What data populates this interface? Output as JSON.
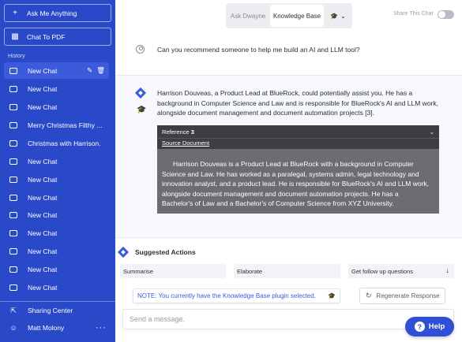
{
  "sidebar": {
    "ask_label": "Ask Me Anything",
    "pdf_label": "Chat To PDF",
    "history_label": "History",
    "items": [
      {
        "label": "New Chat"
      },
      {
        "label": "New Chat"
      },
      {
        "label": "New Chat"
      },
      {
        "label": "Merry Christmas Filthy ..."
      },
      {
        "label": "Christmas with Harrison."
      },
      {
        "label": "New Chat"
      },
      {
        "label": "New Chat"
      },
      {
        "label": "New Chat"
      },
      {
        "label": "New Chat"
      },
      {
        "label": "New Chat"
      },
      {
        "label": "New Chat"
      },
      {
        "label": "New Chat"
      },
      {
        "label": "New Chat"
      }
    ],
    "sharing_label": "Sharing Center",
    "user_name": "Matt Molony"
  },
  "topbar": {
    "mode_ask": "Ask Dwayne",
    "mode_kb": "Knowledge Base",
    "share_label": "Share This Chat"
  },
  "chat": {
    "user_message": "Can you recommend someone to help me build an AI and LLM tool?",
    "bot_message": "Harrison Douveas, a Product Lead at BlueRock, could potentially assist you. He has a background in Computer Science and Law and is responsible for BlueRock's AI and LLM work, alongside document management and document automation projects [3].",
    "reference": {
      "title_prefix": "Reference",
      "number": "3",
      "source_link": "Source Document",
      "body": "Harrison Douveas is a Product Lead at BlueRock with a background in Computer Science and Law. He has worked as a paralegal, systems admin, legal technology and innovation analyst, and a product lead. He is responsible for BlueRock's AI and LLM work, alongside document management and document automation projects. He has a Bachelor's of Law and a Bachelor's of Computer Science from XYZ University."
    }
  },
  "suggestions": {
    "title": "Suggested Actions",
    "items": [
      "Summarise",
      "Elaborate",
      "Get follow up questions"
    ]
  },
  "note": "NOTE: You currently have the Knowledge Base plugin selected.",
  "regenerate_label": "Regenerate Response",
  "input": {
    "placeholder": "Send a message."
  },
  "help_label": "Help",
  "colors": {
    "sidebar": "#2a49c9",
    "accent": "#3b5bdb",
    "help": "#2f4fd6",
    "reference_bg": "#6b6d71"
  },
  "icons": [
    "plus-icon",
    "pdf-icon",
    "chat-bubble-icon",
    "edit-icon",
    "trash-icon",
    "share-icon",
    "user-icon",
    "more-icon",
    "ai-hat-icon",
    "chevron-down-icon",
    "arrow-down-icon",
    "refresh-icon",
    "help-icon",
    "diamond-logo-icon"
  ]
}
